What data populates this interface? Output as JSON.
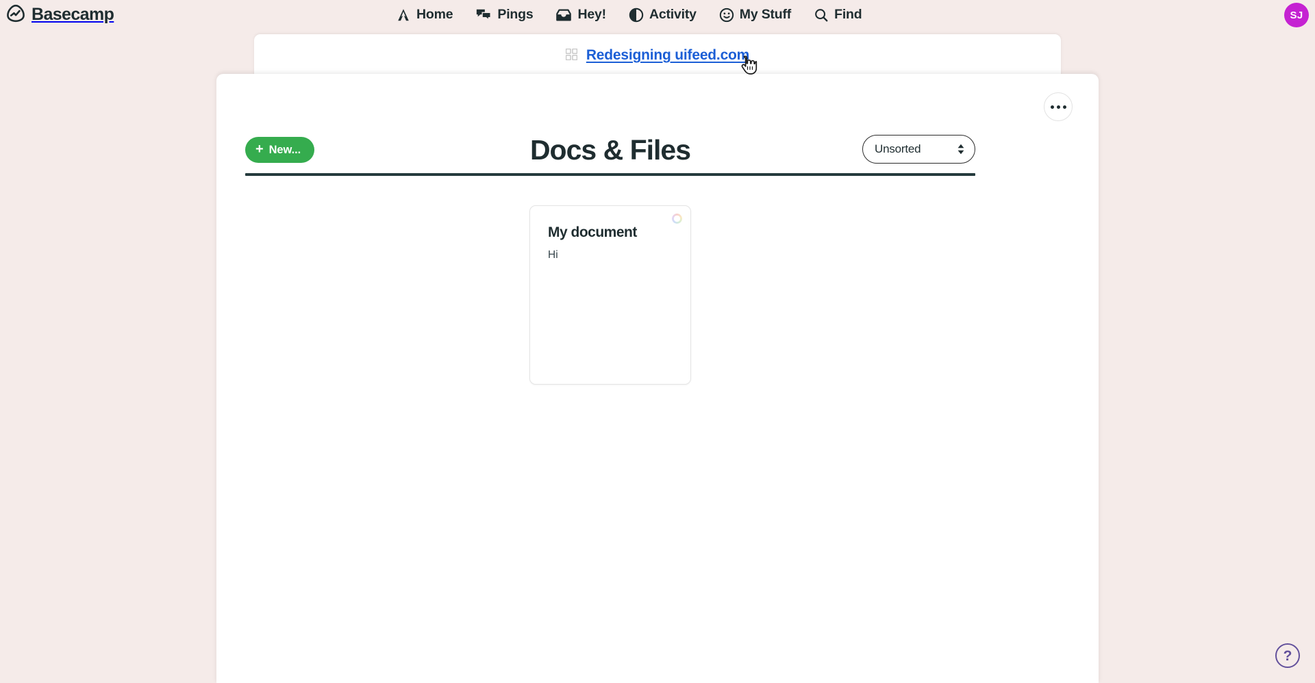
{
  "app": {
    "brand_name": "Basecamp",
    "brand_icon": "basecamp-logo-icon"
  },
  "nav": {
    "items": [
      {
        "label": "Home",
        "icon": "home-icon"
      },
      {
        "label": "Pings",
        "icon": "chat-bubbles-icon"
      },
      {
        "label": "Hey!",
        "icon": "inbox-tray-icon"
      },
      {
        "label": "Activity",
        "icon": "pie-clock-icon"
      },
      {
        "label": "My Stuff",
        "icon": "smiley-face-icon"
      },
      {
        "label": "Find",
        "icon": "search-icon"
      }
    ],
    "avatar": {
      "initials": "SJ",
      "color": "#c522d2"
    }
  },
  "project": {
    "name": "Redesigning uifeed.com",
    "icon": "grid-squares-icon",
    "link_color": "#1c5fd6"
  },
  "panel": {
    "more_menu_label": "•••",
    "more_menu_icon": "ellipsis-icon"
  },
  "toolbar": {
    "new_label": "New...",
    "new_plus": "+",
    "new_color": "#35ac4e",
    "sort_value": "Unsorted",
    "sort_icon": "up-down-arrows-icon"
  },
  "page": {
    "title": "Docs & Files",
    "rule_color": "#253b3d"
  },
  "docs": [
    {
      "title": "My document",
      "excerpt": "Hi",
      "status_icon": "loading-ring-icon"
    }
  ],
  "help": {
    "label": "?",
    "icon": "question-mark-icon",
    "color": "#63519c"
  },
  "cursor": {
    "icon": "pointing-hand-cursor"
  }
}
